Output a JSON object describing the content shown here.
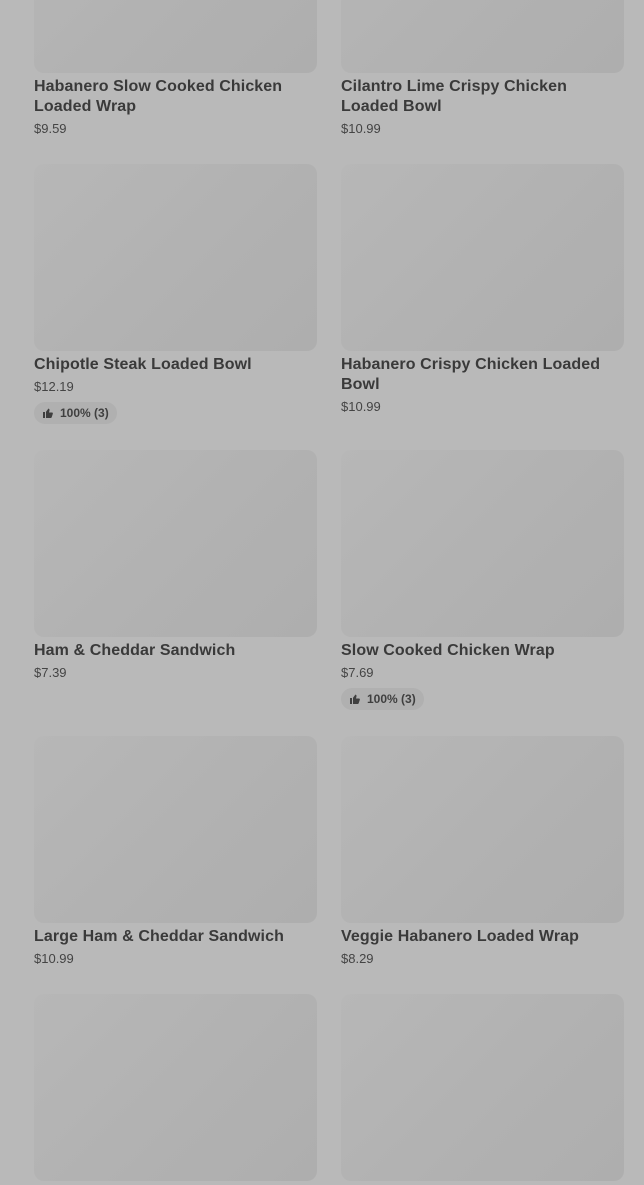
{
  "products": [
    {
      "name": "Habanero Slow Cooked Chicken Loaded Wrap",
      "price": "$9.59"
    },
    {
      "name": "Cilantro Lime Crispy Chicken Loaded Bowl",
      "price": "$10.99"
    },
    {
      "name": "Chipotle Steak Loaded Bowl",
      "price": "$12.19",
      "rating": "100% (3)"
    },
    {
      "name": "Habanero Crispy Chicken Loaded Bowl",
      "price": "$10.99"
    },
    {
      "name": "Ham & Cheddar Sandwich",
      "price": "$7.39"
    },
    {
      "name": "Slow Cooked Chicken Wrap",
      "price": "$7.69",
      "rating": "100% (3)"
    },
    {
      "name": "Large Ham & Cheddar Sandwich",
      "price": "$10.99"
    },
    {
      "name": "Veggie Habanero Loaded Wrap",
      "price": "$8.29"
    },
    {
      "name": "",
      "price": ""
    },
    {
      "name": "",
      "price": ""
    }
  ],
  "icons": {
    "rating": "thumbs-up-icon"
  },
  "colors": {
    "background": "#b9b9b9",
    "thumbnail": "#b3b3b3",
    "text": "#3a3a3a",
    "rating_pill": "#b0b0b0"
  }
}
